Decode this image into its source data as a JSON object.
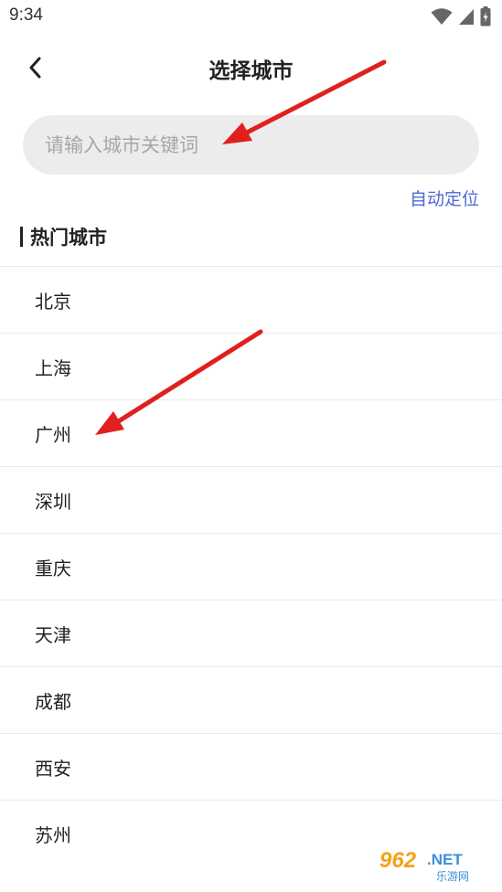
{
  "status_bar": {
    "time": "9:34"
  },
  "header": {
    "title": "选择城市",
    "back_icon": "chevron-left-icon"
  },
  "search": {
    "placeholder": "请输入城市关键词",
    "value": ""
  },
  "auto_locate_label": "自动定位",
  "section": {
    "title": "热门城市"
  },
  "cities": [
    "北京",
    "上海",
    "广州",
    "深圳",
    "重庆",
    "天津",
    "成都",
    "西安",
    "苏州"
  ],
  "watermark": {
    "brand": "962.NET",
    "sub": "乐游网"
  },
  "colors": {
    "accent": "#4d6ad2",
    "search_bg": "#ececec",
    "arrow": "#e0201e"
  }
}
